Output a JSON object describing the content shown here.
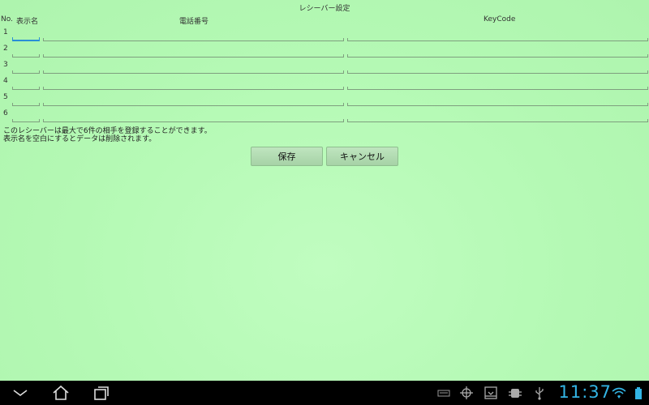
{
  "app": {
    "title": "レシーバー設定",
    "headers": {
      "no": "No.",
      "name": "表示名",
      "phone": "電話番号",
      "keycode": "KeyCode"
    },
    "rows": [
      {
        "num": "1",
        "name": "",
        "phone": "",
        "keycode": ""
      },
      {
        "num": "2",
        "name": "",
        "phone": "",
        "keycode": ""
      },
      {
        "num": "3",
        "name": "",
        "phone": "",
        "keycode": ""
      },
      {
        "num": "4",
        "name": "",
        "phone": "",
        "keycode": ""
      },
      {
        "num": "5",
        "name": "",
        "phone": "",
        "keycode": ""
      },
      {
        "num": "6",
        "name": "",
        "phone": "",
        "keycode": ""
      }
    ],
    "notes": [
      "このレシーバーは最大で6件の相手を登録することができます。",
      "表示名を空白にするとデータは削除されます。"
    ],
    "buttons": {
      "save": "保存",
      "cancel": "キャンセル"
    }
  },
  "system_bar": {
    "time": "11:37",
    "icons": [
      "back-icon",
      "home-icon",
      "recent-apps-icon",
      "keyboard-icon",
      "gps-icon",
      "download-icon",
      "debug-icon",
      "usb-icon",
      "wifi-icon",
      "battery-icon"
    ],
    "clock_color": "#33b5e5"
  }
}
